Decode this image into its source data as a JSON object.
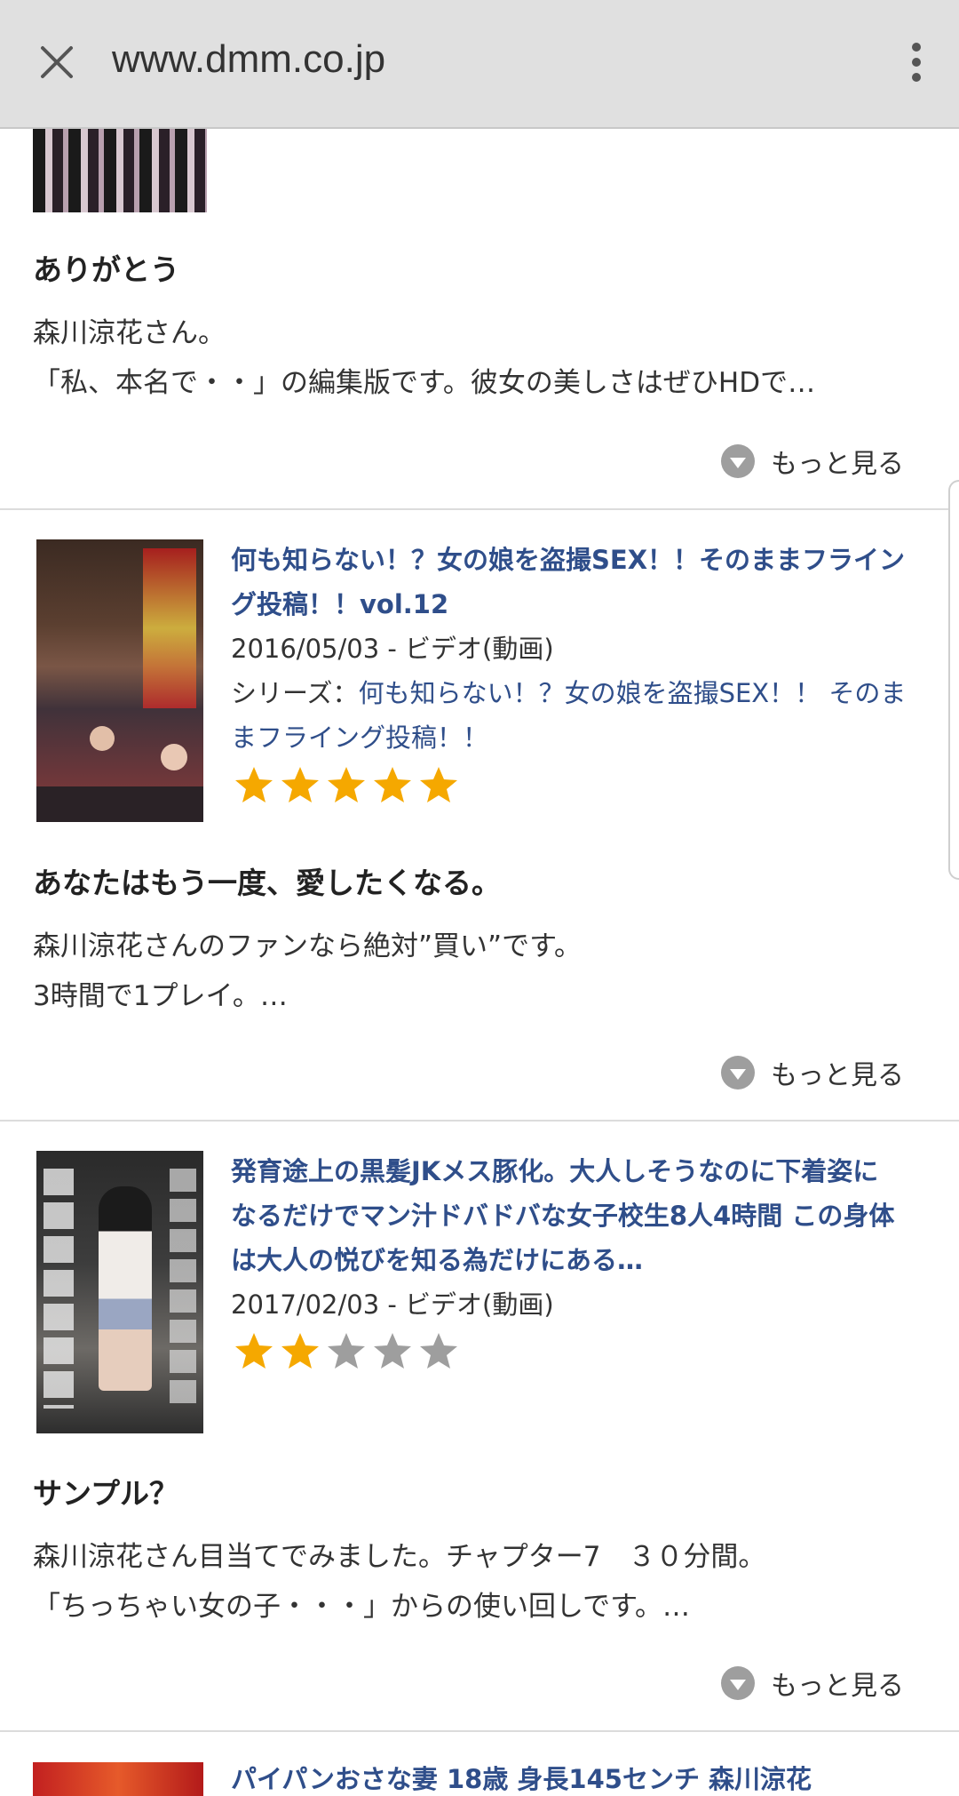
{
  "browser": {
    "url": "www.dmm.co.jp"
  },
  "reviews": [
    {
      "title": "ありがとう",
      "body_lines": [
        "森川涼花さん。",
        "「私、本名で・・」の編集版です。彼女の美しさはぜひHDで…"
      ],
      "more_label": "もっと見る"
    },
    {
      "item_title_lines": [
        "何も知らない！？女の娘を盗撮SEX！！そのままフライン",
        "グ投稿！！vol.12"
      ],
      "date_type": "2016/05/03 - ビデオ(動画)",
      "series_label": "シリーズ：",
      "series_link_lines": [
        "何も知らない！？女の娘を盗撮SEX！！ そのま",
        "まフライング投稿！！"
      ],
      "rating": 5,
      "title": "あなたはもう一度、愛したくなる。",
      "body_lines": [
        "森川涼花さんのファンなら絶対”買い”です。",
        "3時間で1プレイ。…"
      ],
      "more_label": "もっと見る"
    },
    {
      "item_title_lines": [
        "発育途上の黒髪JKメス豚化。大人しそうなのに下着姿に",
        "なるだけでマン汁ドバドバな女子校生8人4時間 この身体",
        "は大人の悦びを知る為だけにある…"
      ],
      "date_type": "2017/02/03 - ビデオ(動画)",
      "rating": 2,
      "title": "サンプル？",
      "body_lines": [
        "森川涼花さん目当てでみました。チャプター7　３０分間。",
        "「ちっちゃい女の子・・・」からの使い回しです。…"
      ],
      "more_label": "もっと見る"
    },
    {
      "item_title_partial": "パイパンおさな妻 18歳 身長145センチ 森川涼花"
    }
  ],
  "colors": {
    "link": "#2f4e8a",
    "star_on": "#f5a800",
    "star_off": "#9e9e9e"
  }
}
